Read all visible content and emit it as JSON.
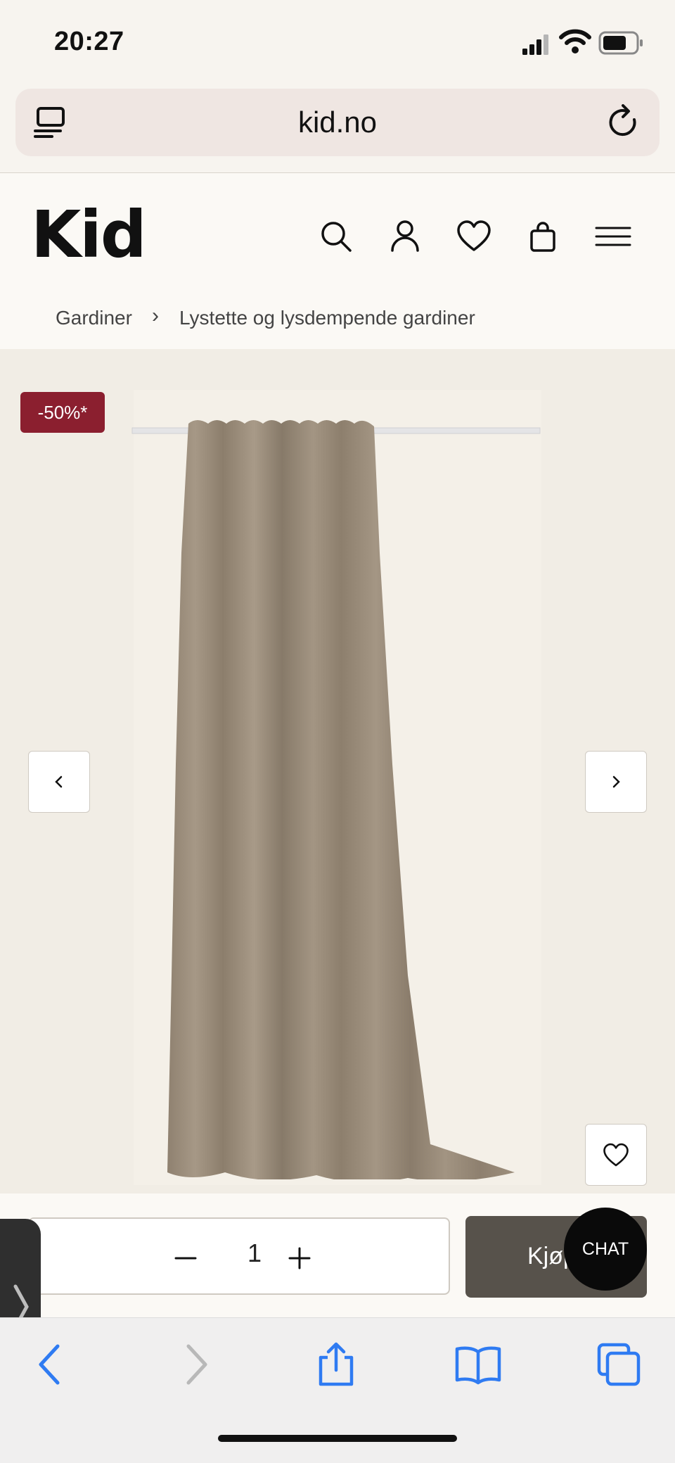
{
  "status_bar": {
    "time": "20:27",
    "icons": [
      "signal-icon",
      "wifi-icon",
      "battery-icon"
    ]
  },
  "browser": {
    "url": "kid.no",
    "icons": [
      "reader-icon",
      "reload-icon"
    ]
  },
  "site": {
    "logo": "Kid",
    "header_icons": [
      "search-icon",
      "account-icon",
      "heart-icon",
      "bag-icon",
      "menu-icon"
    ]
  },
  "breadcrumb": {
    "items": [
      "Gardiner",
      "Lystette og lysdempende gardiner"
    ],
    "separator": "›"
  },
  "product": {
    "discount_badge": "-50%*",
    "badge_color": "#8b1f2f",
    "curtain_color": "#9a8c79"
  },
  "purchase": {
    "quantity": "1",
    "buy_label": "Kjøp",
    "chat_label": "CHAT",
    "button_color": "#57524b"
  },
  "toolbar": {
    "icons": [
      "back-icon",
      "forward-icon",
      "share-icon",
      "bookmarks-icon",
      "tabs-icon"
    ]
  }
}
